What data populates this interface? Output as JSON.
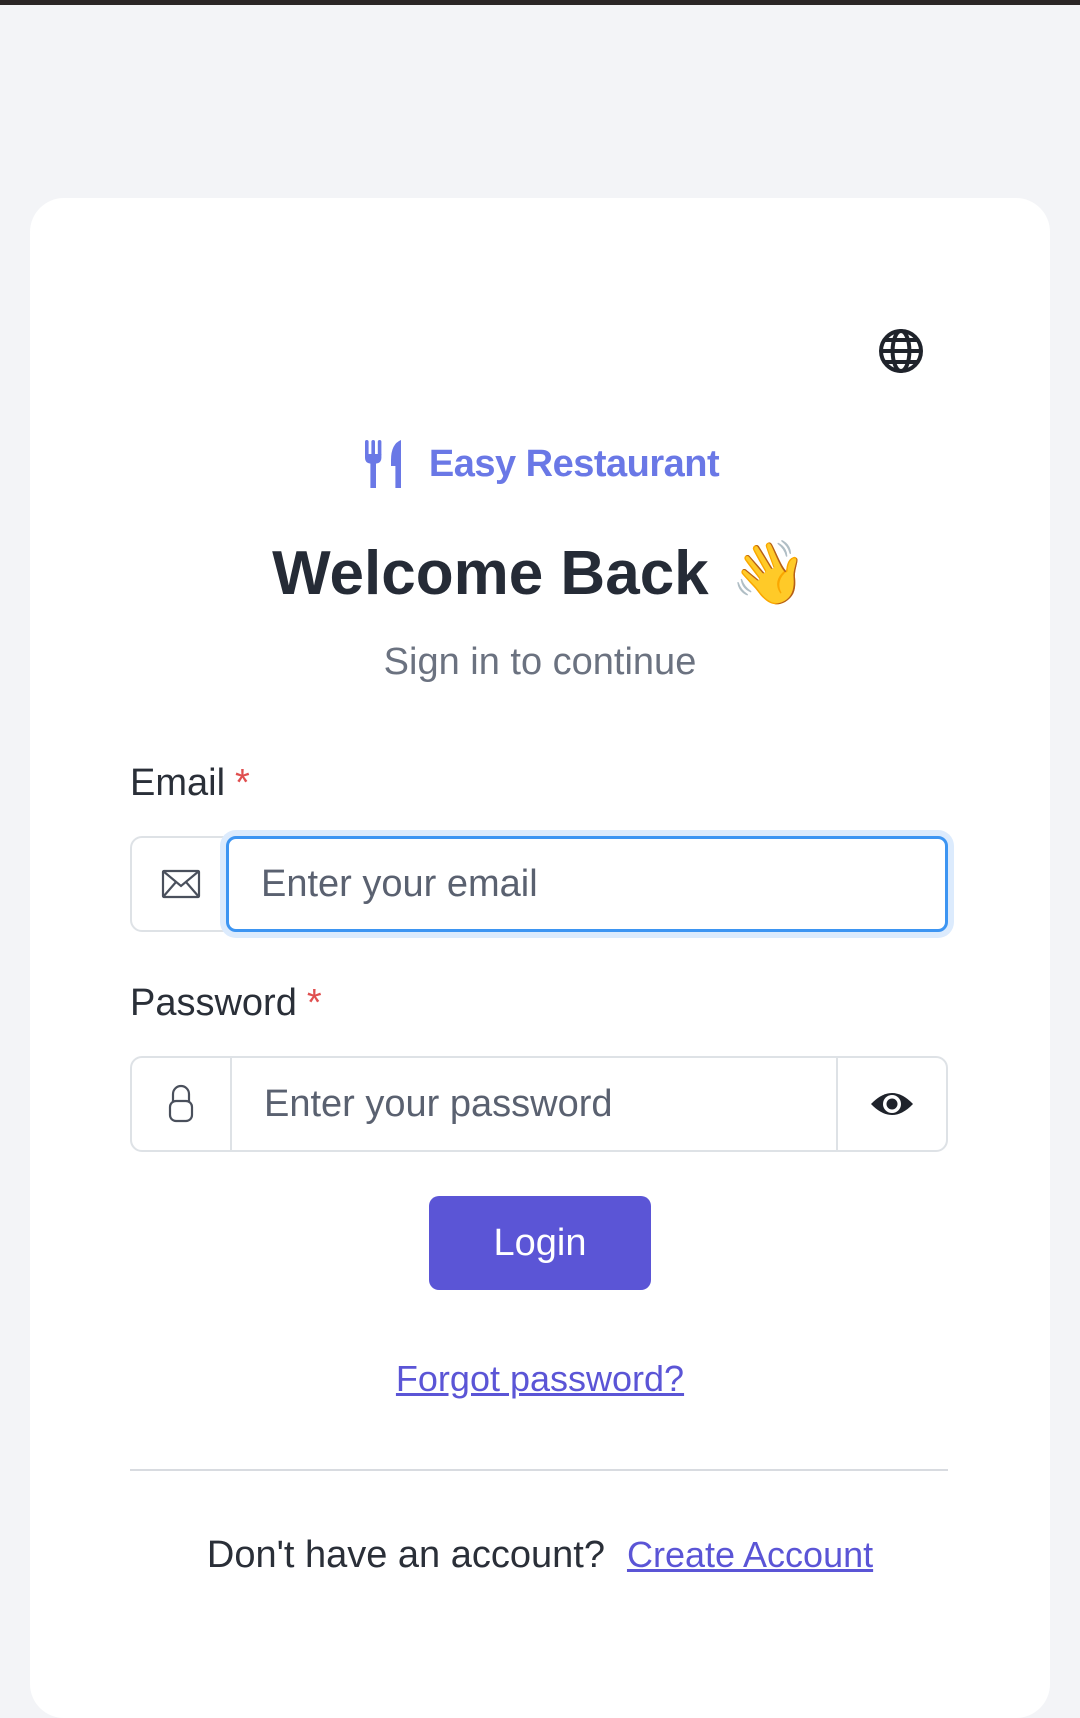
{
  "brand": {
    "name": "Easy Restaurant",
    "icon": "utensils-icon",
    "color": "#6a78e6"
  },
  "header": {
    "language_icon": "globe-icon"
  },
  "heading": {
    "title": "Welcome Back",
    "emoji": "👋",
    "subtitle": "Sign in to continue"
  },
  "form": {
    "email": {
      "label": "Email",
      "required_mark": "*",
      "placeholder": "Enter your email",
      "value": "",
      "icon": "envelope-icon"
    },
    "password": {
      "label": "Password",
      "required_mark": "*",
      "placeholder": "Enter your password",
      "value": "",
      "icon": "lock-icon",
      "toggle_icon": "eye-icon"
    },
    "login_label": "Login"
  },
  "links": {
    "forgot_password": "Forgot password?",
    "no_account_text": "Don't have an account?",
    "create_account": "Create Account"
  },
  "colors": {
    "primary": "#5b55d6",
    "focus": "#3d95f2",
    "required": "#e04f4f",
    "background": "#f3f4f7"
  }
}
